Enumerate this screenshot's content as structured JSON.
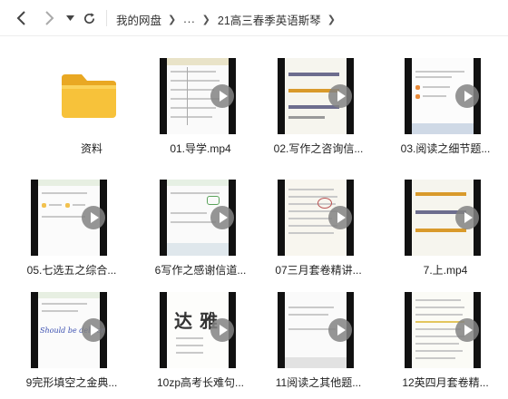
{
  "toolbar": {
    "back_icon": "chevron-left-icon",
    "forward_icon": "chevron-right-icon",
    "dropdown_icon": "caret-down-icon",
    "refresh_icon": "refresh-icon"
  },
  "breadcrumb": {
    "root": "我的网盘",
    "ellipsis": "...",
    "current": "21高三春季英语斯琴"
  },
  "files": [
    {
      "name": "资料",
      "type": "folder"
    },
    {
      "name": "01.导学.mp4",
      "type": "video"
    },
    {
      "name": "02.写作之咨询信...",
      "type": "video"
    },
    {
      "name": "03.阅读之细节题...",
      "type": "video"
    },
    {
      "name": "05.七选五之综合...",
      "type": "video"
    },
    {
      "name": "6写作之感谢信道...",
      "type": "video"
    },
    {
      "name": "07三月套卷精讲...",
      "type": "video"
    },
    {
      "name": "7.上.mp4",
      "type": "video"
    },
    {
      "name": "9完形填空之金典...",
      "type": "video"
    },
    {
      "name": "10zp高考长难句...",
      "type": "video"
    },
    {
      "name": "11阅读之其他题...",
      "type": "video"
    },
    {
      "name": "12英四月套卷精...",
      "type": "video"
    }
  ],
  "thumb_text": {
    "t10_left": "达",
    "t10_right": "雅",
    "t9_handwriting": "Should be deliver"
  },
  "colors": {
    "folder": "#f7c23a",
    "play_button": "#808080"
  }
}
